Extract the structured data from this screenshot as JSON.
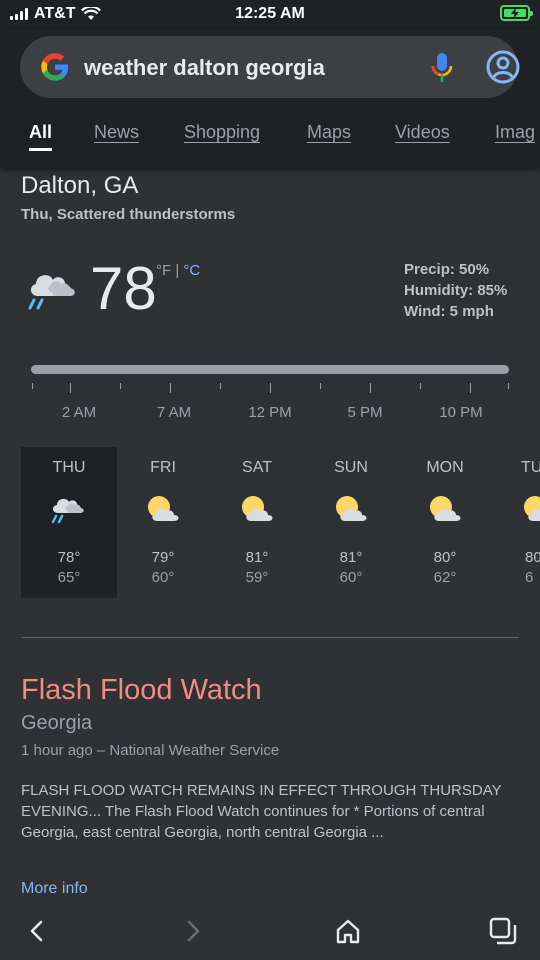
{
  "status_bar": {
    "carrier": "AT&T",
    "time": "12:25 AM"
  },
  "search": {
    "query": "weather dalton georgia"
  },
  "tabs": [
    {
      "label": "All",
      "active": true
    },
    {
      "label": "News"
    },
    {
      "label": "Shopping"
    },
    {
      "label": "Maps"
    },
    {
      "label": "Videos"
    },
    {
      "label": "Imag"
    }
  ],
  "weather": {
    "location": "Dalton, GA",
    "condition": "Thu, Scattered thunderstorms",
    "temperature": "78",
    "unit_f": "°F",
    "unit_sep": " | ",
    "unit_c": "°C",
    "precip": "Precip: 50%",
    "humidity": "Humidity: 85%",
    "wind": "Wind: 5 mph",
    "times": [
      "2 AM",
      "7 AM",
      "12 PM",
      "5 PM",
      "10 PM"
    ],
    "forecast": [
      {
        "day": "THU",
        "icon": "thunderstorm-icon",
        "hi": "78°",
        "lo": "65°"
      },
      {
        "day": "FRI",
        "icon": "partly-cloudy-icon",
        "hi": "79°",
        "lo": "60°"
      },
      {
        "day": "SAT",
        "icon": "partly-cloudy-icon",
        "hi": "81°",
        "lo": "59°"
      },
      {
        "day": "SUN",
        "icon": "partly-cloudy-icon",
        "hi": "81°",
        "lo": "60°"
      },
      {
        "day": "MON",
        "icon": "partly-cloudy-icon",
        "hi": "80°",
        "lo": "62°"
      },
      {
        "day": "TU",
        "icon": "partly-cloudy-icon",
        "hi": "80",
        "lo": "6"
      }
    ]
  },
  "alert": {
    "title": "Flash Flood Watch",
    "region": "Georgia",
    "meta": "1 hour ago – National Weather Service",
    "body": "FLASH FLOOD WATCH REMAINS IN EFFECT THROUGH THURSDAY EVENING... The Flash Flood Watch continues for * Portions of central Georgia, east central Georgia, north central Georgia ...",
    "more": "More info"
  },
  "colors": {
    "accent": "#8ab4f8",
    "alert": "#f28b82",
    "sun": "#fdd663",
    "battery": "#4cd964"
  }
}
